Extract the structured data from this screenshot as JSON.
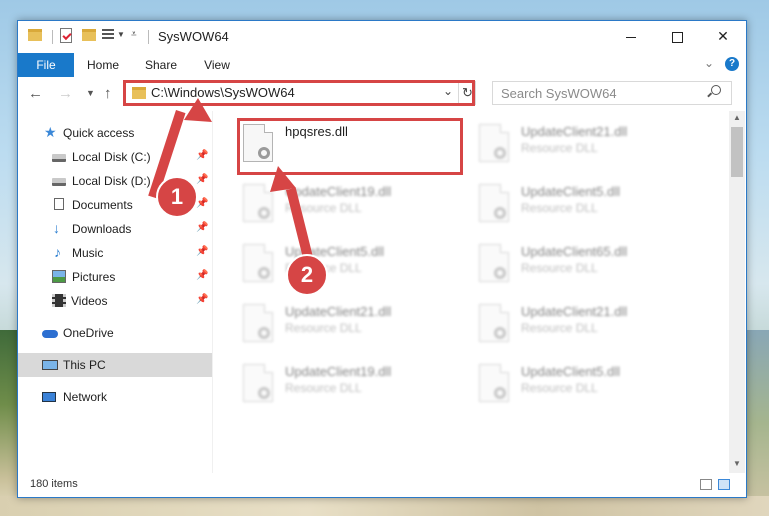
{
  "window": {
    "title": "SysWOW64",
    "controls": {
      "minimize": "—",
      "maximize": "☐",
      "close": "✕"
    }
  },
  "ribbon": {
    "tabs": [
      "File",
      "Home",
      "Share",
      "View"
    ],
    "help_label": "?"
  },
  "navigation": {
    "address": "C:\\Windows\\SysWOW64",
    "search_placeholder": "Search SysWOW64"
  },
  "sidebar": {
    "items": [
      {
        "label": "Quick access",
        "icon": "star-icon"
      },
      {
        "label": "Local Disk (C:)",
        "icon": "drive-icon",
        "pinned": true
      },
      {
        "label": "Local Disk (D:)",
        "icon": "drive-icon",
        "pinned": true
      },
      {
        "label": "Documents",
        "icon": "documents-icon",
        "pinned": true
      },
      {
        "label": "Downloads",
        "icon": "download-icon",
        "pinned": true
      },
      {
        "label": "Music",
        "icon": "music-icon",
        "pinned": true
      },
      {
        "label": "Pictures",
        "icon": "pictures-icon",
        "pinned": true
      },
      {
        "label": "Videos",
        "icon": "videos-icon",
        "pinned": true
      },
      {
        "label": "OneDrive",
        "icon": "cloud-icon"
      },
      {
        "label": "This PC",
        "icon": "computer-icon",
        "selected": true
      },
      {
        "label": "Network",
        "icon": "network-icon"
      }
    ]
  },
  "files": [
    {
      "name": "hpqsres.dll",
      "type": "",
      "highlighted": true
    },
    {
      "name": "UpdateClient21.dll",
      "type": "Resource DLL"
    },
    {
      "name": "UpdateClient19.dll",
      "type": "Resource DLL"
    },
    {
      "name": "UpdateClient5.dll",
      "type": "Resource DLL"
    },
    {
      "name": "UpdateClient5.dll",
      "type": "Resource DLL"
    },
    {
      "name": "UpdateClient65.dll",
      "type": "Resource DLL"
    },
    {
      "name": "UpdateClient21.dll",
      "type": "Resource DLL"
    },
    {
      "name": "UpdateClient21.dll",
      "type": "Resource DLL"
    },
    {
      "name": "UpdateClient19.dll",
      "type": "Resource DLL"
    },
    {
      "name": "UpdateClient5.dll",
      "type": "Resource DLL"
    }
  ],
  "status": {
    "item_count": "180 items"
  },
  "callouts": {
    "step1": "1",
    "step2": "2"
  },
  "colors": {
    "accent": "#1979ca",
    "highlight": "#d64545"
  }
}
